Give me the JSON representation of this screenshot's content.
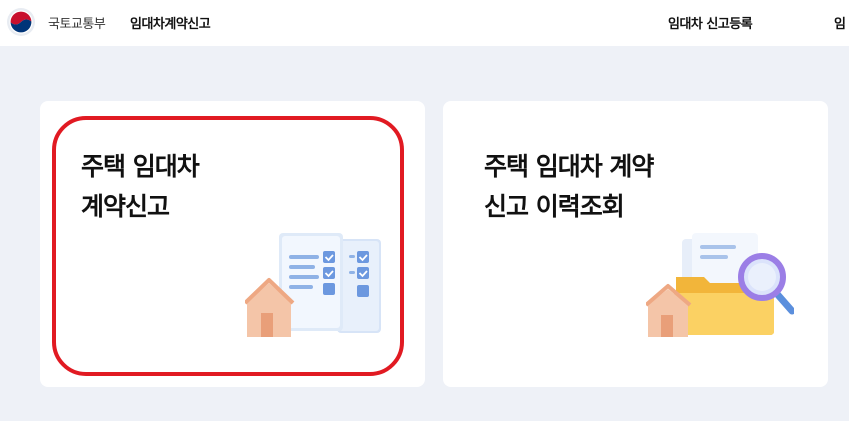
{
  "header": {
    "ministry_name": "국토교통부",
    "service_name": "임대차계약신고",
    "nav_items": [
      {
        "label": "임대차 신고등록"
      },
      {
        "label": "임"
      }
    ]
  },
  "cards": [
    {
      "title_line1": "주택 임대차",
      "title_line2": "계약신고",
      "illustration": "house-checklist-icon"
    },
    {
      "title_line1": "주택 임대차 계약",
      "title_line2": "신고 이력조회",
      "illustration": "folder-search-icon"
    }
  ],
  "colors": {
    "background": "#eef1f7",
    "card": "#ffffff",
    "highlight": "#e11a22",
    "emblem_red": "#c8102e",
    "emblem_blue": "#003478"
  }
}
